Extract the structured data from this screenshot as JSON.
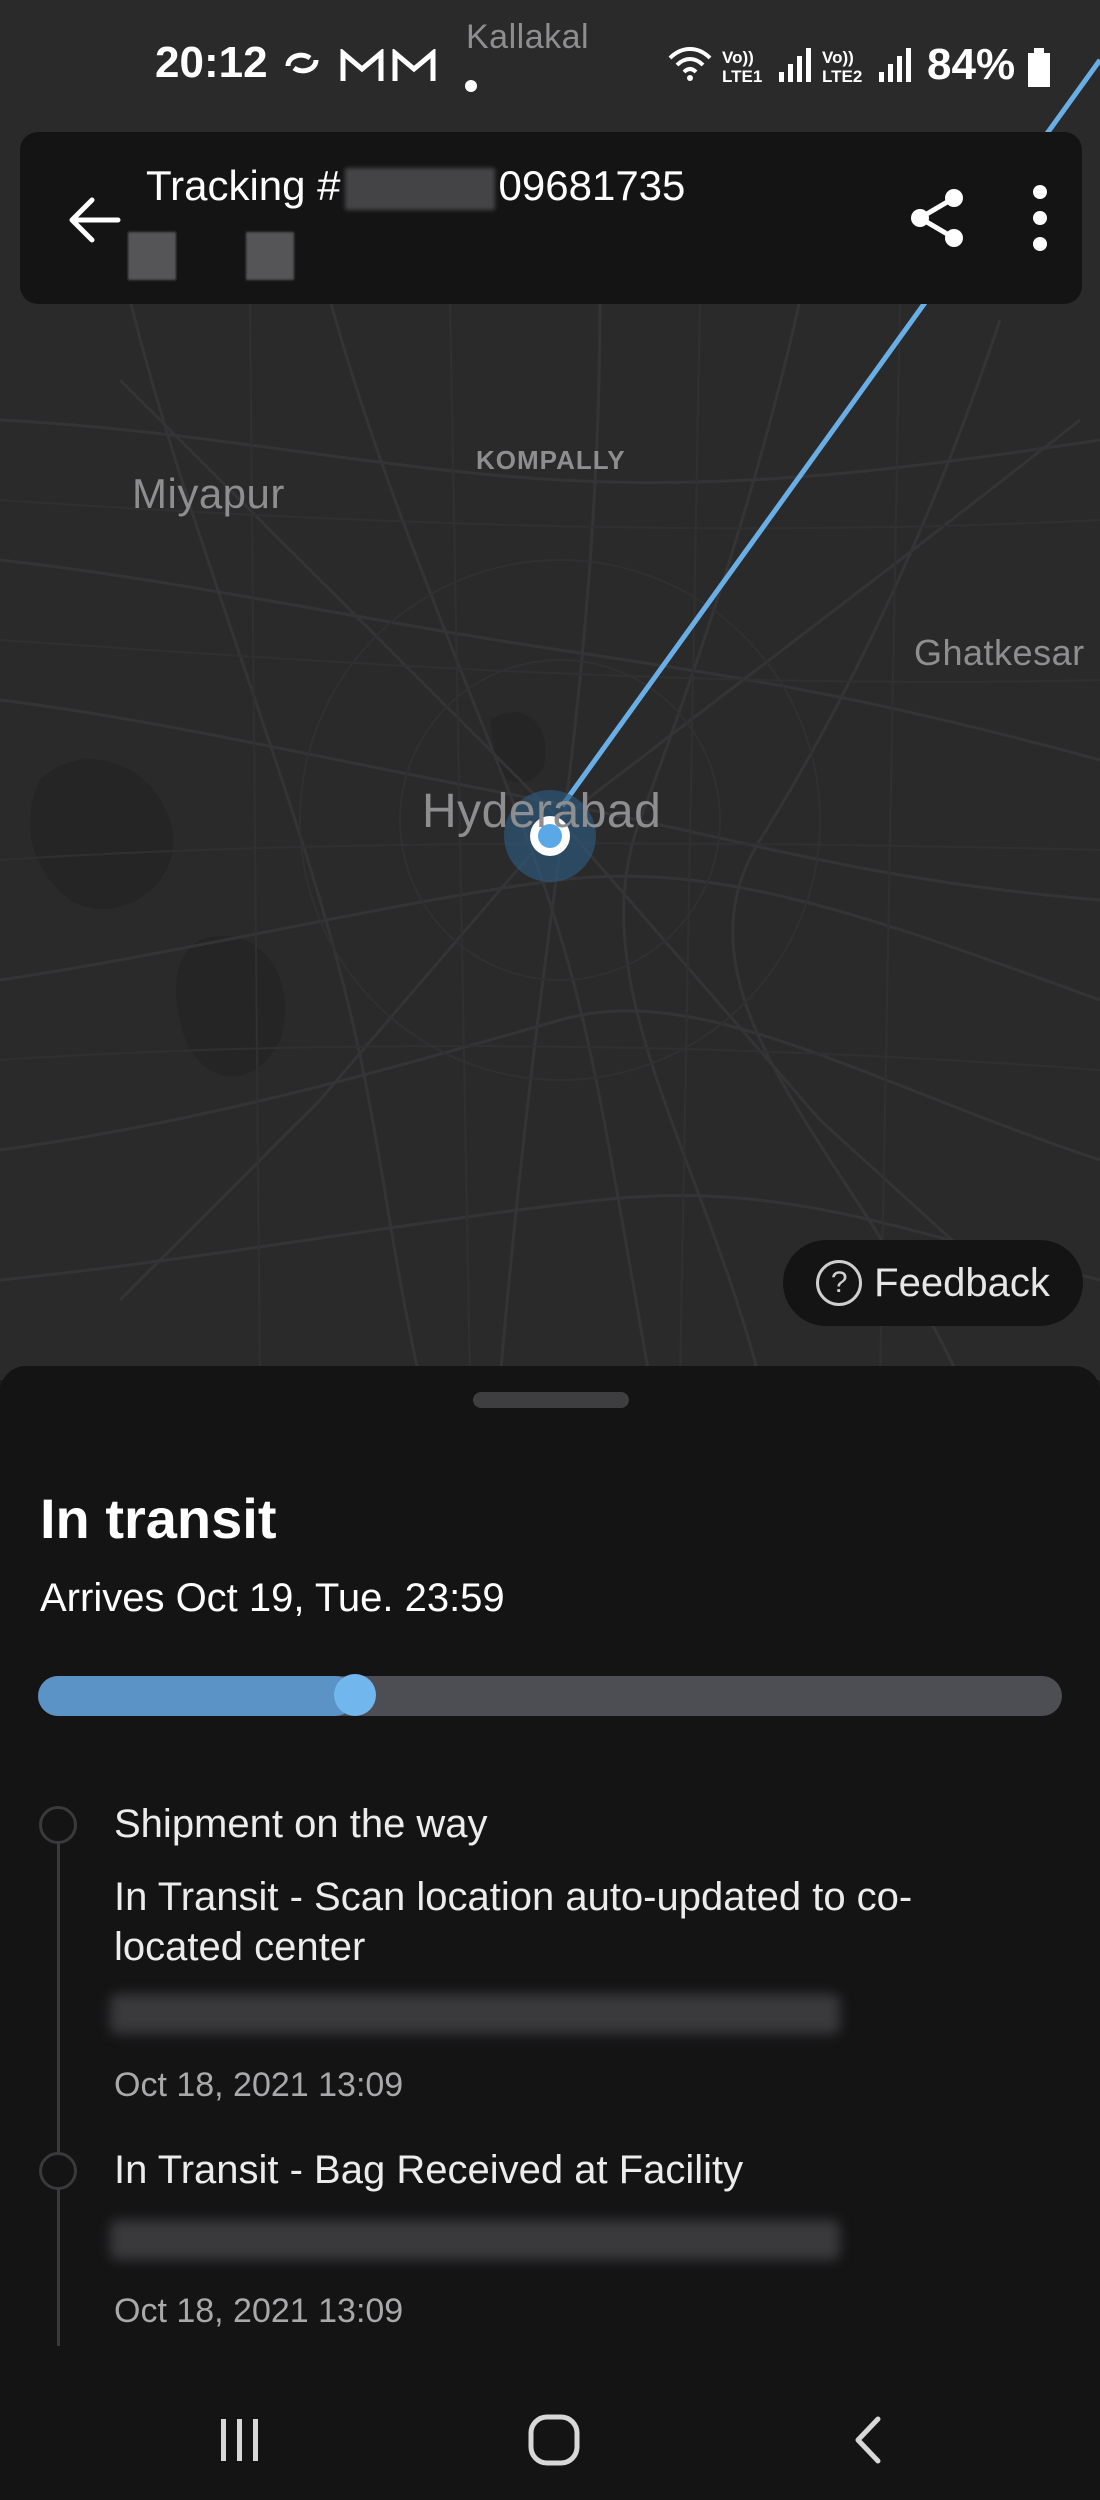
{
  "status_bar": {
    "time": "20:12",
    "icons": [
      "sync-icon",
      "gmail-icon",
      "gmail-icon",
      "dot-icon",
      "wifi-icon",
      "signal-lte1-icon",
      "signal-lte2-icon",
      "battery-icon"
    ],
    "lte1_label": "Vo)) LTE1",
    "lte2_label": "Vo)) LTE2",
    "battery": "84%"
  },
  "map": {
    "labels": {
      "kallakal": "Kallakal",
      "kompally": "KOMPALLY",
      "miyapur": "Miyapur",
      "ghatkesar": "Ghatkesar",
      "hyderabad": "Hyderabad"
    },
    "route_color": "#6aaee6",
    "marker_color": "#5aa8e6"
  },
  "header": {
    "title_prefix": "Tracking #",
    "tracking_suffix": "09681735",
    "back_icon": "arrow-left-icon",
    "share_icon": "share-icon",
    "more_icon": "more-vertical-icon"
  },
  "feedback": {
    "label": "Feedback",
    "icon": "help-circle-icon",
    "icon_glyph": "?"
  },
  "sheet": {
    "status": "In transit",
    "arrival": "Arrives Oct 19, Tue. 23:59",
    "progress_percent": 31,
    "progress_color": "#5b93c6",
    "events": [
      {
        "title": "Shipment on the way",
        "description": "In Transit - Scan location auto-updated to co-located center",
        "timestamp": "Oct 18, 2021 13:09"
      },
      {
        "title": "In Transit - Bag Received at Facility",
        "timestamp": "Oct 18, 2021 13:09"
      }
    ]
  },
  "nav": {
    "recents_icon": "recents-icon",
    "home_icon": "home-icon",
    "back_icon": "nav-back-icon"
  }
}
